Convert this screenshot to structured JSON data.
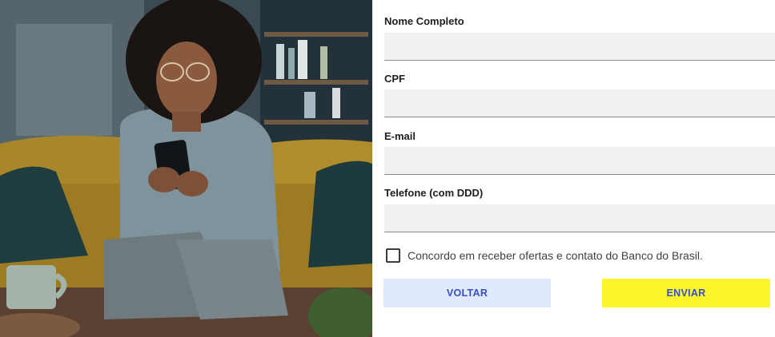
{
  "form": {
    "fields": [
      {
        "label": "Nome Completo",
        "value": "",
        "placeholder": ""
      },
      {
        "label": "CPF",
        "value": "",
        "placeholder": ""
      },
      {
        "label": "E-mail",
        "value": "",
        "placeholder": ""
      },
      {
        "label": "Telefone (com DDD)",
        "value": "",
        "placeholder": ""
      }
    ],
    "consent": {
      "checked": false,
      "label": "Concordo em receber ofertas e contato do Banco do Brasil."
    },
    "buttons": {
      "back": "VOLTAR",
      "send": "ENVIAR"
    }
  },
  "colors": {
    "field_bg": "#f0f1f3",
    "back_button_bg": "#e1eafc",
    "send_button_bg": "#fcf52a",
    "button_text": "#3650c9"
  }
}
